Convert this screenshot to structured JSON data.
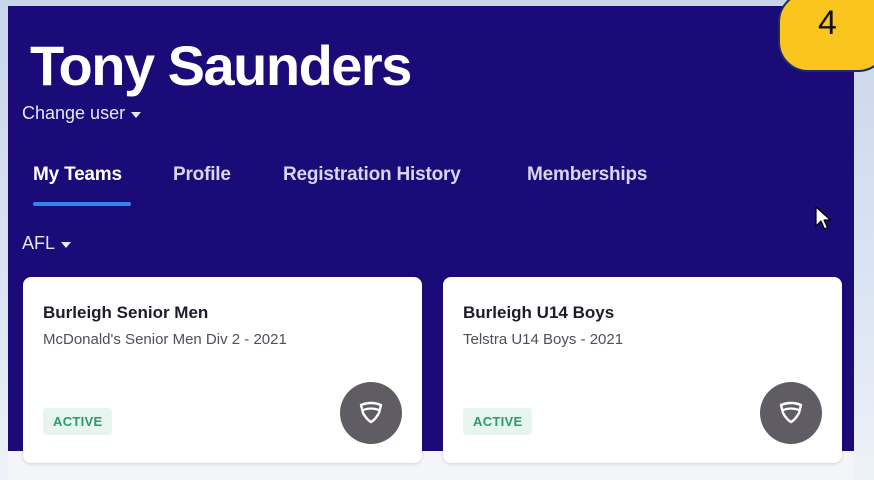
{
  "header": {
    "user_name": "Tony Saunders",
    "change_user_label": "Change user"
  },
  "tabs": [
    {
      "label": "My Teams",
      "active": true
    },
    {
      "label": "Profile",
      "active": false
    },
    {
      "label": "Registration History",
      "active": false
    },
    {
      "label": "Memberships",
      "active": false
    }
  ],
  "sport_filter": {
    "selected": "AFL"
  },
  "teams": [
    {
      "name": "Burleigh Senior Men",
      "competition": "McDonald's Senior Men Div 2 - 2021",
      "status": "ACTIVE"
    },
    {
      "name": "Burleigh U14 Boys",
      "competition": "Telstra U14 Boys - 2021",
      "status": "ACTIVE"
    }
  ],
  "step_badge": "4",
  "icons": [
    "chevron-down-icon",
    "shield-icon",
    "mouse-cursor-icon"
  ],
  "colors": {
    "header_bg": "#1a0b78",
    "active_tab_underline": "#2f86f0",
    "status_active": "#2d9a6a",
    "step_badge": "#f9c51e"
  }
}
